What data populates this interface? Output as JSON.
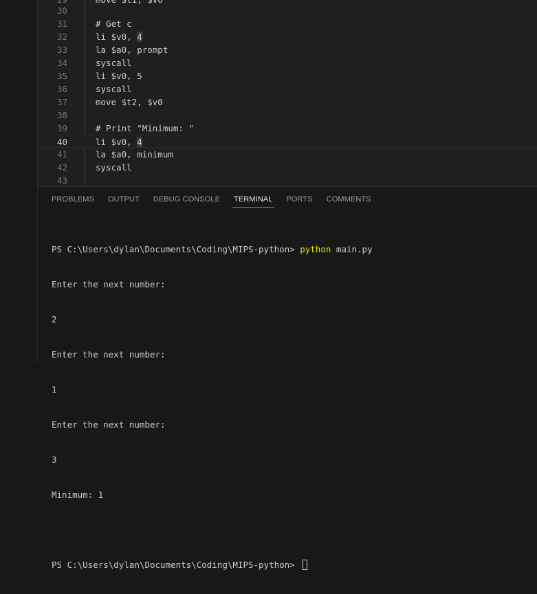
{
  "editor": {
    "lines": [
      {
        "number": "29",
        "code": "move $t1, $v0"
      },
      {
        "number": "30",
        "code": ""
      },
      {
        "number": "31",
        "code": "# Get c"
      },
      {
        "number": "32",
        "code_pre": "li $v0, ",
        "code_hl": "4"
      },
      {
        "number": "33",
        "code": "la $a0, prompt"
      },
      {
        "number": "34",
        "code": "syscall"
      },
      {
        "number": "35",
        "code": "li $v0, 5"
      },
      {
        "number": "36",
        "code": "syscall"
      },
      {
        "number": "37",
        "code": "move $t2, $v0"
      },
      {
        "number": "38",
        "code": ""
      },
      {
        "number": "39",
        "code": "# Print \"Minimum: \""
      },
      {
        "number": "40",
        "code_pre": "li $v0, ",
        "code_hl": "4",
        "current": true
      },
      {
        "number": "41",
        "code": "la $a0, minimum"
      },
      {
        "number": "42",
        "code": "syscall"
      },
      {
        "number": "43",
        "code": ""
      }
    ]
  },
  "panel": {
    "tabs": [
      "PROBLEMS",
      "OUTPUT",
      "DEBUG CONSOLE",
      "TERMINAL",
      "PORTS",
      "COMMENTS"
    ],
    "active_tab": "TERMINAL"
  },
  "terminal": {
    "prompt": "PS C:\\Users\\dylan\\Documents\\Coding\\MIPS-python> ",
    "command": "python",
    "command_args": " main.py",
    "output": [
      "Enter the next number:",
      "2",
      "Enter the next number:",
      "1",
      "Enter the next number:",
      "3",
      "Minimum: 1",
      ""
    ],
    "final_prompt": "PS C:\\Users\\dylan\\Documents\\Coding\\MIPS-python> "
  },
  "colors": {
    "editor_bg": "#1f1f1f",
    "panel_bg": "#181818",
    "active_tab_underline": "#5f6ed0",
    "command_color": "#e5e510"
  }
}
